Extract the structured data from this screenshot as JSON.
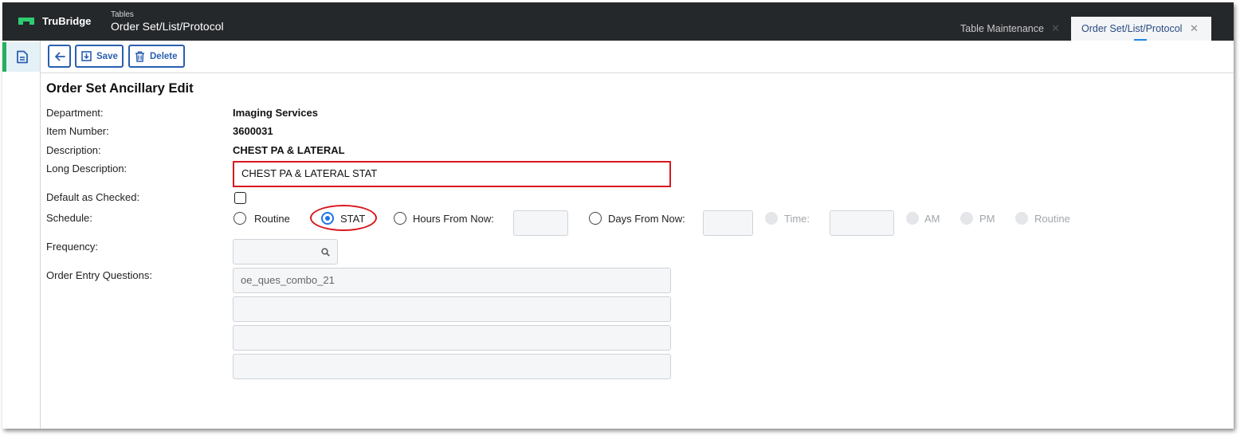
{
  "header": {
    "brand": "TruBridge",
    "breadcrumb_small": "Tables",
    "breadcrumb_title": "Order Set/List/Protocol",
    "tabs": [
      {
        "label": "Table Maintenance",
        "active": false
      },
      {
        "label": "Order Set/List/Protocol",
        "active": true
      }
    ],
    "close_glyph": "✕"
  },
  "toolbar": {
    "back_icon": "arrow-left-icon",
    "save_label": "Save",
    "delete_label": "Delete"
  },
  "form": {
    "title": "Order Set Ancillary Edit",
    "department_label": "Department:",
    "department_value": "Imaging Services",
    "item_number_label": "Item Number:",
    "item_number_value": "3600031",
    "description_label": "Description:",
    "description_value": "CHEST PA & LATERAL",
    "long_description_label": "Long Description:",
    "long_description_value": "CHEST PA & LATERAL STAT",
    "default_checked_label": "Default as Checked:",
    "default_checked": false,
    "schedule_label": "Schedule:",
    "schedule_options": {
      "routine": "Routine",
      "stat": "STAT",
      "hours_from_now": "Hours From Now:",
      "days_from_now": "Days From Now:",
      "time": "Time:",
      "am": "AM",
      "pm": "PM",
      "routine2": "Routine"
    },
    "schedule_selected": "STAT",
    "frequency_label": "Frequency:",
    "frequency_value": "",
    "oe_questions_label": "Order Entry Questions:",
    "oe_questions": [
      "oe_ques_combo_21",
      "",
      "",
      ""
    ]
  },
  "colors": {
    "header_bg": "#25282b",
    "accent_blue": "#2a5fb0",
    "radio_blue": "#1e73e8",
    "highlight_red": "#d7191e",
    "rail_green": "#27ae60"
  }
}
